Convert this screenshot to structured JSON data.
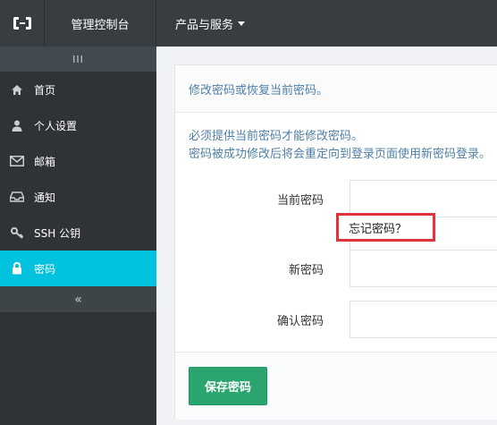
{
  "header": {
    "console_title": "管理控制台",
    "products_label": "产品与服务"
  },
  "sidebar": {
    "collapse_top": "III",
    "items": [
      {
        "label": "首页",
        "icon": "home-icon",
        "active": false
      },
      {
        "label": "个人设置",
        "icon": "user-icon",
        "active": false
      },
      {
        "label": "邮箱",
        "icon": "mail-icon",
        "active": false
      },
      {
        "label": "通知",
        "icon": "inbox-icon",
        "active": false
      },
      {
        "label": "SSH 公钥",
        "icon": "key-icon",
        "active": false
      },
      {
        "label": "密码",
        "icon": "lock-icon",
        "active": true
      }
    ],
    "collapse_bottom": "«"
  },
  "main": {
    "panel_title": "修改密码或恢复当前密码。",
    "notice_line1": "必须提供当前密码才能修改密码。",
    "notice_line2": "密码被成功修改后将会重定向到登录页面使用新密码登录。",
    "fields": {
      "current_password_label": "当前密码",
      "forgot_password_link": "忘记密码？",
      "new_password_label": "新密码",
      "confirm_password_label": "确认密码"
    },
    "save_button": "保存密码"
  },
  "colors": {
    "topbar": "#373d41",
    "sidebar": "#2f3337",
    "active_item": "#00c1de",
    "save_button": "#2ba56e",
    "highlight_border": "#e0343a",
    "notice_text": "#4f7fa8"
  }
}
